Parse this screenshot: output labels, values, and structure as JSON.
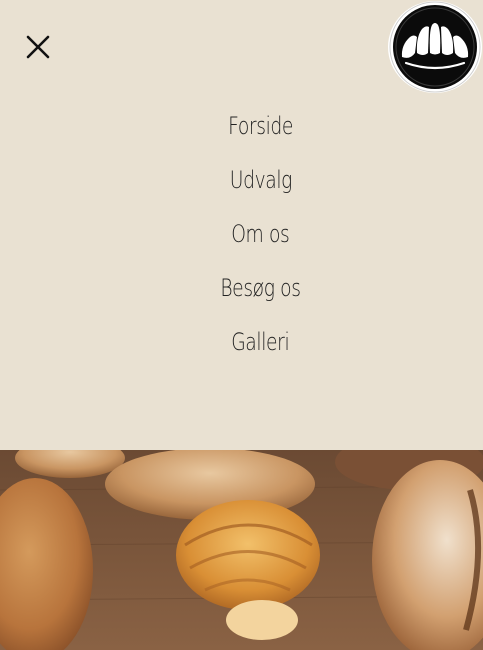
{
  "icons": {
    "close": "close-icon",
    "logo": "croissant-logo-icon"
  },
  "nav": {
    "items": [
      {
        "label": "Forside"
      },
      {
        "label": "Udvalg"
      },
      {
        "label": "Om os"
      },
      {
        "label": "Besøg os"
      },
      {
        "label": "Galleri"
      }
    ]
  },
  "colors": {
    "background": "#e9e1d2",
    "text": "#222222",
    "logo_fill": "#0b0b0b"
  }
}
